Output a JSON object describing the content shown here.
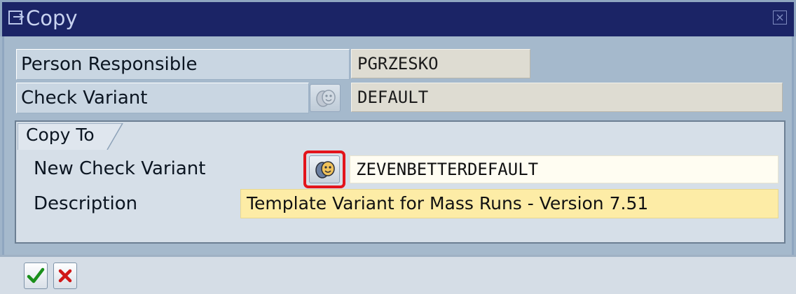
{
  "dialog": {
    "title": "Copy",
    "icons": {
      "title": "window-icon",
      "close": "close-icon"
    }
  },
  "fields": {
    "person_responsible": {
      "label": "Person Responsible",
      "value": "PGRZESKO"
    },
    "check_variant": {
      "label": "Check Variant",
      "value": "DEFAULT",
      "icon": "masks-icon"
    }
  },
  "copy_to": {
    "title": "Copy To",
    "new_check_variant": {
      "label": "New Check Variant",
      "value": "ZEVENBETTERDEFAULT",
      "icon": "masks-icon",
      "highlight_color": "#e3141c"
    },
    "description": {
      "label": "Description",
      "value": "Template Variant for Mass Runs - Version 7.51"
    }
  },
  "footer": {
    "confirm_icon": "checkmark-icon",
    "cancel_icon": "cancel-x-icon",
    "colors": {
      "confirm": "#1a8f1a",
      "cancel": "#d01818"
    }
  }
}
